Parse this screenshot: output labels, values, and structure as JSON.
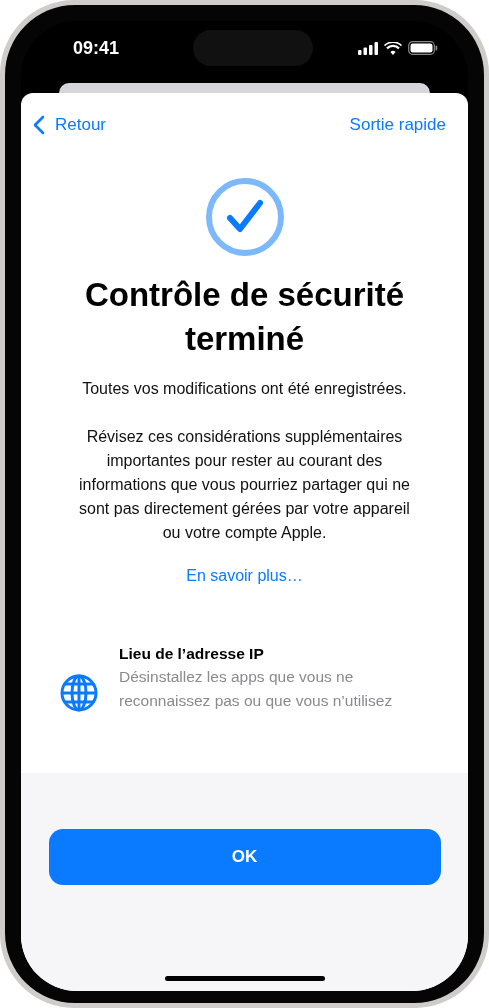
{
  "status_bar": {
    "time": "09:41"
  },
  "nav": {
    "back": "Retour",
    "exit": "Sortie rapide"
  },
  "title": "Contrôle de sécurité terminé",
  "messages": [
    "Toutes vos modifications ont été enregistrées.",
    "Révisez ces considérations supplémentaires importantes pour rester au courant des informations que vous pourriez partager qui ne sont pas directement gérées par votre appareil ou votre compte Apple."
  ],
  "link": "En savoir plus…",
  "items": [
    {
      "title": "Lieu de l’adresse IP",
      "description": "Désinstallez les apps que vous ne reconnaissez pas ou que vous n’utilisez"
    }
  ],
  "button": "OK"
}
